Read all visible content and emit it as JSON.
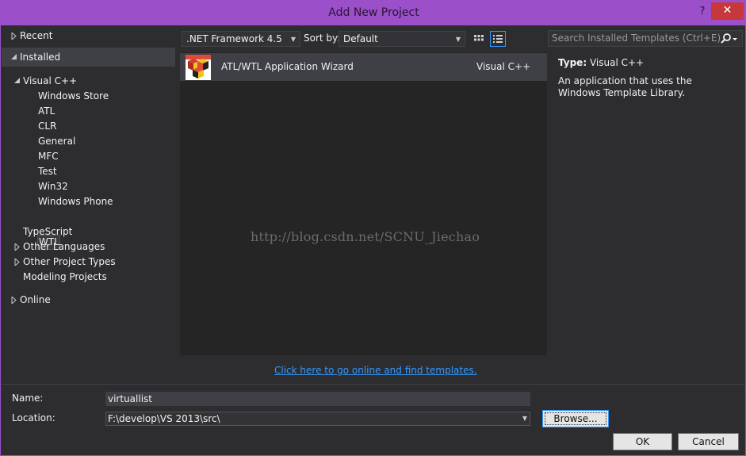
{
  "window": {
    "title": "Add New Project",
    "help_label": "?",
    "close_label": "✕"
  },
  "nav": {
    "recent": "Recent",
    "installed": "Installed",
    "visual_cpp": "Visual C++",
    "children": [
      "Windows Store",
      "ATL",
      "CLR",
      "General",
      "MFC",
      "Test",
      "Win32",
      "Windows Phone",
      "WTL"
    ],
    "typescript": "TypeScript",
    "other_languages": "Other Languages",
    "other_project_types": "Other Project Types",
    "modeling_projects": "Modeling Projects",
    "online": "Online"
  },
  "toolbar": {
    "framework": ".NET Framework 4.5",
    "sort_label": "Sort by:",
    "sort_value": "Default",
    "search_placeholder": "Search Installed Templates (Ctrl+E)"
  },
  "templates": [
    {
      "name": "ATL/WTL Application Wizard",
      "language": "Visual C++"
    }
  ],
  "details": {
    "type_label": "Type:",
    "type_value": "Visual C++",
    "description": "An application that uses the Windows Template Library."
  },
  "watermark": "http://blog.csdn.net/SCNU_Jiechao",
  "online_link": "Click here to go online and find templates.",
  "form": {
    "name_label": "Name:",
    "name_value": "virtuallist",
    "location_label": "Location:",
    "location_value": "F:\\develop\\VS 2013\\src\\",
    "browse_label": "Browse...",
    "ok_label": "OK",
    "cancel_label": "Cancel"
  },
  "colors": {
    "titlebar": "#9b4fc9",
    "background": "#2d2d30",
    "accent": "#3399ff",
    "close": "#c7383a"
  }
}
